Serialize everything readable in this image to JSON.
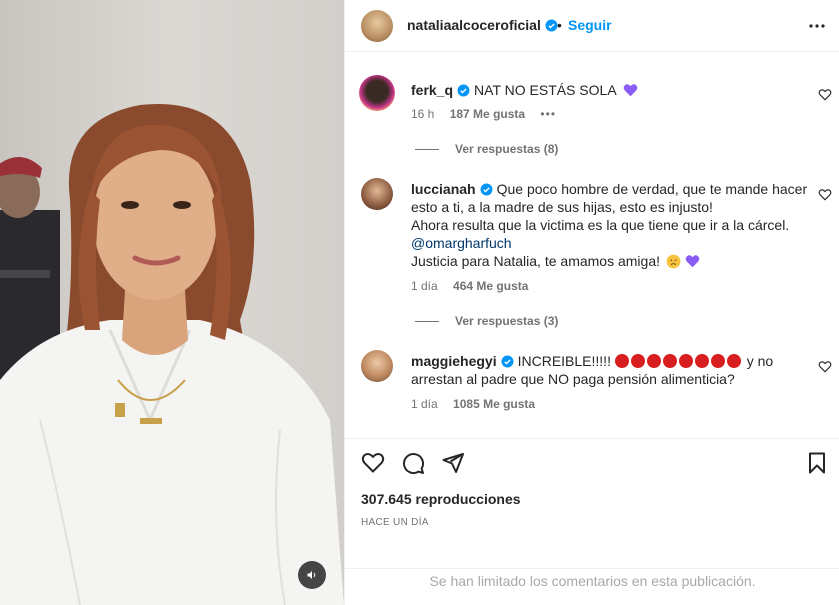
{
  "post": {
    "author": "nataliaalcoceroficial",
    "separator": "•",
    "follow_label": "Seguir"
  },
  "comments": [
    {
      "username": "ferk_q",
      "text": "NAT NO ESTÁS SOLA",
      "time": "16 h",
      "likes": "187 Me gusta",
      "dots": "•••",
      "replies": "Ver respuestas (8)"
    },
    {
      "username": "luccianah",
      "text1": "Que poco hombre de verdad, que te mande hacer esto a ti, a la madre de sus hijas, esto es injusto!",
      "text2": "Ahora resulta que la victima es la que tiene que ir a la cárcel.",
      "mention": "@omargharfuch",
      "text3": "Justicia para Natalia, te amamos amiga!",
      "time": "1 día",
      "likes": "464 Me gusta",
      "replies": "Ver respuestas (3)"
    },
    {
      "username": "maggiehegyi",
      "text1": "INCREIBLE!!!!!",
      "text2": "y no arrestan al padre que NO paga pensión alimenticia?",
      "time": "1 día",
      "likes": "1085 Me gusta"
    }
  ],
  "stats": {
    "views": "307.645 reproducciones",
    "date": "HACE UN DÍA"
  },
  "footer": {
    "limited": "Se han limitado los comentarios en esta publicación."
  },
  "icons": {
    "verified_color": "#0095f6",
    "purple_heart": "#8a5cf5",
    "angry": "#d81e1e"
  }
}
